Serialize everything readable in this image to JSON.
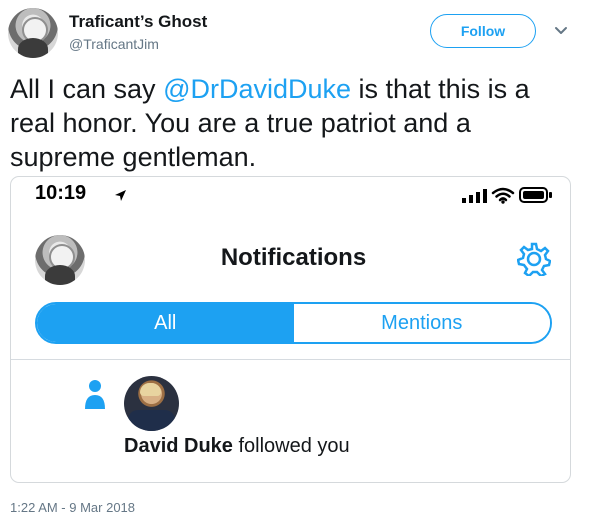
{
  "tweet": {
    "display_name": "Traficant’s Ghost",
    "screen_name": "@TraficantJim",
    "follow_label": "Follow",
    "text_before": "All I can say ",
    "mention": "@DrDavidDuke",
    "text_after": " is that this is a real honor. You are a true patriot and a supreme gentleman.",
    "timestamp": "1:22 AM - 9 Mar 2018"
  },
  "embedded_screenshot": {
    "status_time": "10:19",
    "title": "Notifications",
    "tabs": [
      {
        "label": "All",
        "active": true
      },
      {
        "label": "Mentions",
        "active": false
      }
    ],
    "notification": {
      "user": "David Duke",
      "action": " followed you"
    }
  },
  "icons": {
    "caret": "chevron-down-icon",
    "location": "location-arrow-icon",
    "signal": "signal-icon",
    "wifi": "wifi-icon",
    "battery": "battery-icon",
    "settings": "gear-icon",
    "follow_notification": "person-icon"
  },
  "colors": {
    "accent": "#1da1f2",
    "text": "#14171a",
    "secondary_text": "#657786",
    "border": "#d5d9dc"
  }
}
